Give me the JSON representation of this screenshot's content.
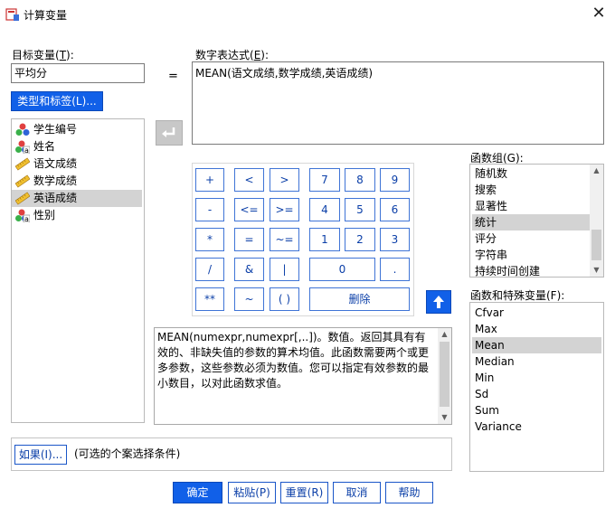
{
  "window": {
    "title": "计算变量",
    "close_glyph": "✕"
  },
  "target": {
    "label_prefix": "目标变量(",
    "label_key": "T",
    "label_suffix": "):",
    "value": "平均分",
    "type_label_button": "类型和标签(L)..."
  },
  "equals": "=",
  "expression": {
    "label_prefix": "数字表达式(",
    "label_key": "E",
    "label_suffix": "):",
    "value": "MEAN(语文成绩,数学成绩,英语成绩)"
  },
  "variables": [
    {
      "name": "学生编号",
      "icon": "nominal-icon"
    },
    {
      "name": "姓名",
      "icon": "nominal-string-icon"
    },
    {
      "name": "语文成绩",
      "icon": "scale-icon"
    },
    {
      "name": "数学成绩",
      "icon": "scale-icon"
    },
    {
      "name": "英语成绩",
      "icon": "scale-icon",
      "selected": true
    },
    {
      "name": "性别",
      "icon": "nominal-string-icon"
    }
  ],
  "keypad": {
    "rows": [
      [
        "+",
        "<",
        ">",
        "7",
        "8",
        "9"
      ],
      [
        "-",
        "<=",
        ">=",
        "4",
        "5",
        "6"
      ],
      [
        "*",
        "=",
        "~=",
        "1",
        "2",
        "3"
      ],
      [
        "/",
        "&",
        "|",
        "0",
        "."
      ],
      [
        "**",
        "~",
        "( )",
        "删除"
      ]
    ]
  },
  "description": "MEAN(numexpr,numexpr[,..])。数值。返回其具有有效的、非缺失值的参数的算术均值。此函数需要两个或更多参数，这些参数必须为数值。您可以指定有效参数的最小数目，以对此函数求值。",
  "function_groups": {
    "label": "函数组(G):",
    "items": [
      "随机数",
      "搜索",
      "显著性",
      "统计",
      "评分",
      "字符串",
      "持续时间创建"
    ],
    "selected_index": 3
  },
  "functions": {
    "label": "函数和特殊变量(F):",
    "items": [
      "Cfvar",
      "Max",
      "Mean",
      "Median",
      "Min",
      "Sd",
      "Sum",
      "Variance"
    ],
    "selected_index": 2
  },
  "if": {
    "button": "如果(I)...",
    "note": "(可选的个案选择条件)"
  },
  "buttons": {
    "ok": "确定",
    "paste": "粘贴(P)",
    "reset": "重置(R)",
    "cancel": "取消",
    "help": "帮助"
  }
}
